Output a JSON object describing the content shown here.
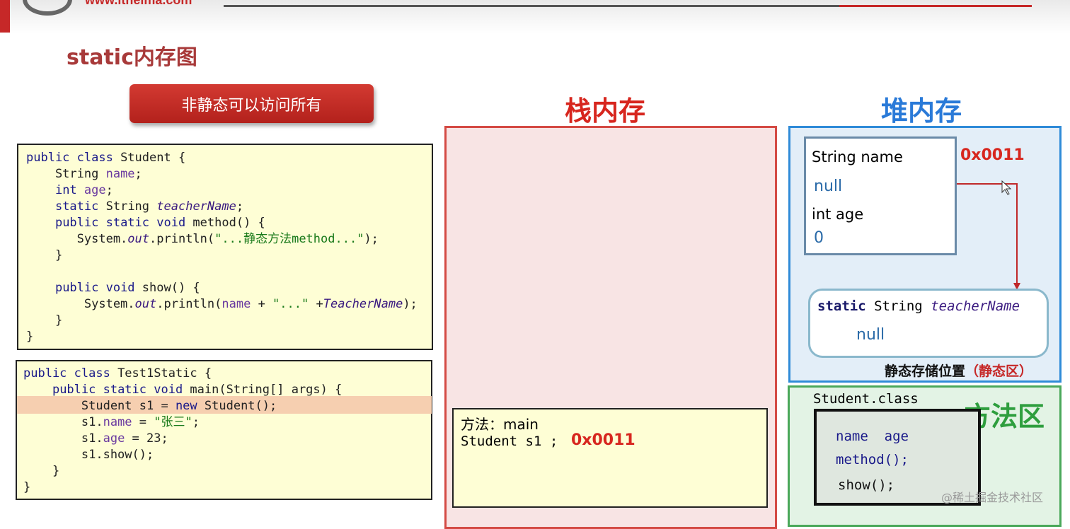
{
  "header": {
    "url": "www.itheima.com"
  },
  "slide_title": "static内存图",
  "banner": "非静态可以访问所有",
  "code_student": [
    "public class Student {",
    "    String name;",
    "    int age;",
    "    static String teacherName;",
    "    public static void method() {",
    "       System.out.println(\"...静态方法method...\");",
    "    }",
    "",
    "    public void show() {",
    "        System.out.println(name + \"...\" +TeacherName);",
    "    }",
    "}"
  ],
  "code_test": [
    "public class Test1Static {",
    "    public static void main(String[] args) {",
    "        Student s1 = new Student();",
    "        s1.name = \"张三\";",
    "        s1.age = 23;",
    "        s1.show();",
    "    }",
    "}"
  ],
  "highlighted_line": "Student s1 = new Student();",
  "stack": {
    "title": "栈内存",
    "frame_label": "方法：main",
    "frame_var": "Student s1 ;",
    "frame_addr": "0x0011"
  },
  "heap": {
    "title": "堆内存",
    "addr": "0x0011",
    "field1_label": "String name",
    "field1_value": "null",
    "field2_label": "int age",
    "field2_value": "0",
    "static_kw": "static",
    "static_type": "String",
    "static_name": "teacherName",
    "static_value": "null",
    "static_caption": "静态存储位置",
    "static_caption_paren": "（静态区）"
  },
  "method_area": {
    "title": "方法区",
    "class_label": "Student.class",
    "items": [
      "name  age",
      "method();",
      "show();"
    ]
  },
  "watermark": "@稀土掘金技术社区",
  "colors": {
    "red": "#d7261e",
    "blue": "#2a7ad8",
    "green": "#2e9e3e"
  }
}
